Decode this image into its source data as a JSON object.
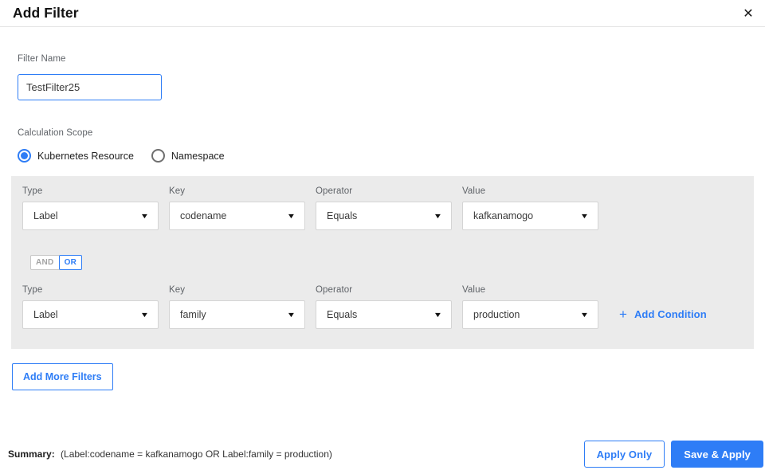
{
  "dialog": {
    "title": "Add Filter"
  },
  "icons": {
    "close": "✕",
    "caret": "▼",
    "plus": "+"
  },
  "filter_name": {
    "label": "Filter Name",
    "value": "TestFilter25"
  },
  "calculation_scope": {
    "label": "Calculation Scope",
    "options": [
      {
        "label": "Kubernetes Resource",
        "selected": true
      },
      {
        "label": "Namespace",
        "selected": false
      }
    ]
  },
  "conditions": {
    "field_labels": {
      "type": "Type",
      "key": "Key",
      "operator": "Operator",
      "value": "Value"
    },
    "rows": [
      {
        "type": "Label",
        "key": "codename",
        "operator": "Equals",
        "value": "kafkanamogo"
      },
      {
        "type": "Label",
        "key": "family",
        "operator": "Equals",
        "value": "production"
      }
    ],
    "logic_toggle": {
      "options": [
        "AND",
        "OR"
      ],
      "selected": "OR"
    },
    "add_condition_label": "Add Condition"
  },
  "add_more_filters_label": "Add More Filters",
  "footer": {
    "summary_label": "Summary:",
    "summary_text": "(Label:codename = kafkanamogo OR Label:family = production)",
    "apply_only_label": "Apply Only",
    "save_apply_label": "Save & Apply"
  },
  "colors": {
    "accent_blue": "#2e7df6",
    "panel_gray": "#ebebeb",
    "border_gray": "#d4d4d4"
  }
}
